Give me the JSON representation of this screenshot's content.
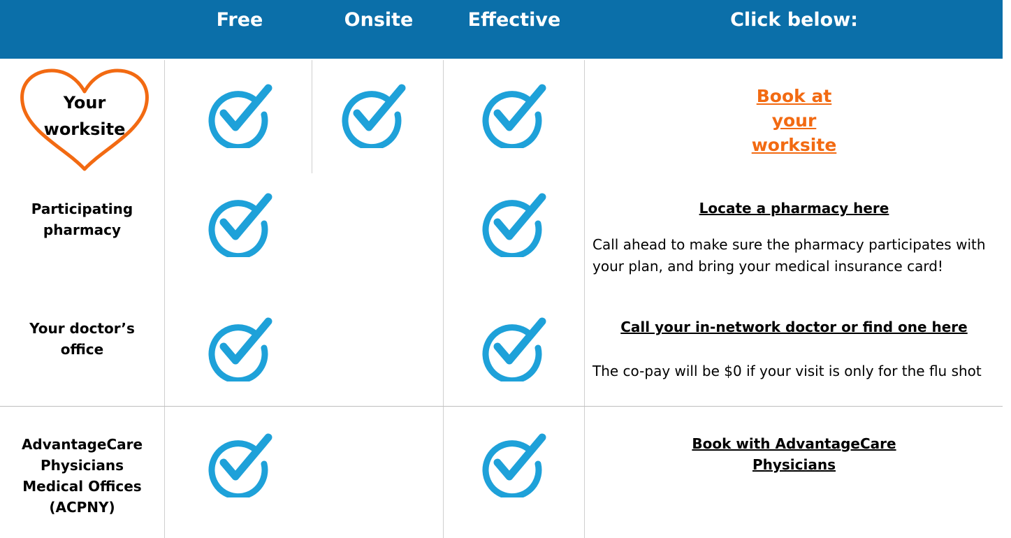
{
  "header": {
    "col_free": "Free",
    "col_onsite": "Onsite",
    "col_effective": "Effective",
    "col_click": "Click below:"
  },
  "rows": [
    {
      "label": "Your worksite",
      "free": true,
      "onsite": true,
      "effective": true,
      "link": "Book at your worksite",
      "note": ""
    },
    {
      "label": "Participating pharmacy",
      "free": true,
      "onsite": false,
      "effective": true,
      "link": "Locate a pharmacy here",
      "note": "Call ahead to make sure the pharmacy participates with your plan, and bring your medical insurance card!"
    },
    {
      "label": "Your doctor’s office",
      "free": true,
      "onsite": false,
      "effective": true,
      "link": "Call your in-network doctor or find one here",
      "note": "The co-pay will be $0 if your visit is only for the flu shot"
    },
    {
      "label": "AdvantageCare Physicians Medical Offices (ACPNY)",
      "free": true,
      "onsite": false,
      "effective": true,
      "link": "Book with AdvantageCare Physicians",
      "note": ""
    }
  ],
  "colors": {
    "header_bg": "#0b6fa9",
    "check": "#1ea1d9",
    "heart": "#f26a12",
    "link_orange": "#f26a12"
  },
  "icons": {
    "check": "checkmark-circle-icon",
    "heart": "heart-outline-icon"
  }
}
